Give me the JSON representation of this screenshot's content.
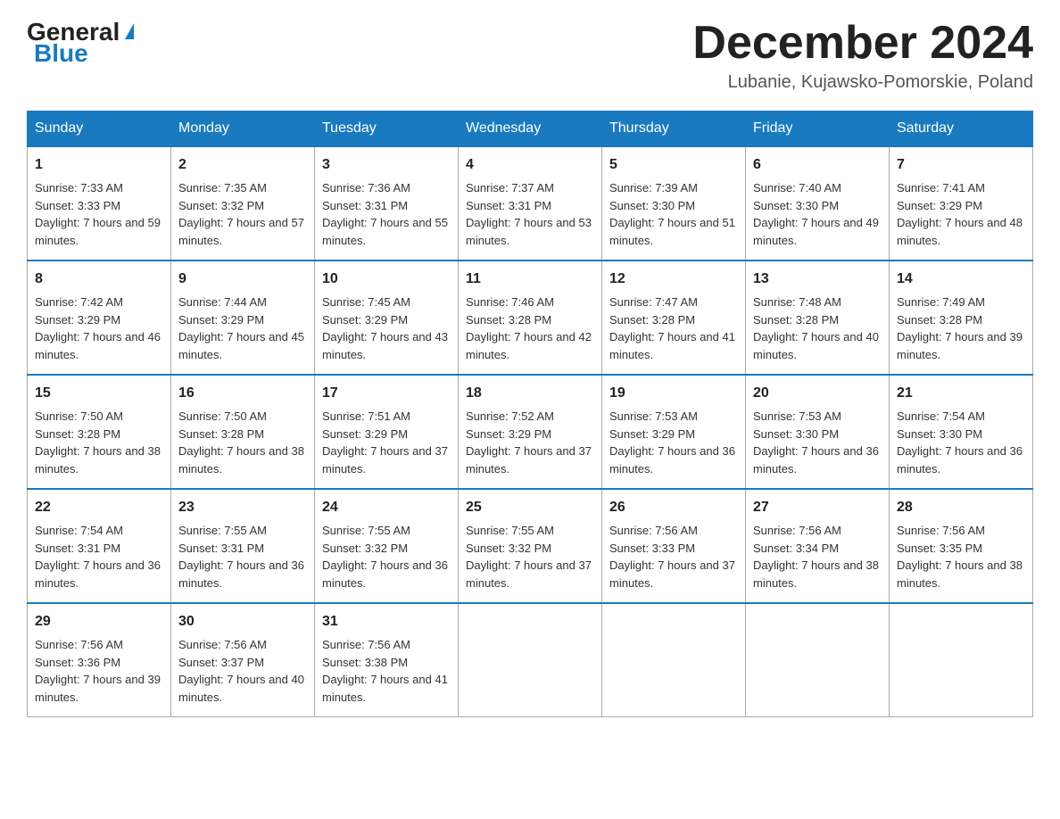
{
  "header": {
    "logo_general": "General",
    "logo_blue": "Blue",
    "month_title": "December 2024",
    "location": "Lubanie, Kujawsko-Pomorskie, Poland"
  },
  "days_of_week": [
    "Sunday",
    "Monday",
    "Tuesday",
    "Wednesday",
    "Thursday",
    "Friday",
    "Saturday"
  ],
  "weeks": [
    [
      {
        "day": "1",
        "sunrise": "Sunrise: 7:33 AM",
        "sunset": "Sunset: 3:33 PM",
        "daylight": "Daylight: 7 hours and 59 minutes."
      },
      {
        "day": "2",
        "sunrise": "Sunrise: 7:35 AM",
        "sunset": "Sunset: 3:32 PM",
        "daylight": "Daylight: 7 hours and 57 minutes."
      },
      {
        "day": "3",
        "sunrise": "Sunrise: 7:36 AM",
        "sunset": "Sunset: 3:31 PM",
        "daylight": "Daylight: 7 hours and 55 minutes."
      },
      {
        "day": "4",
        "sunrise": "Sunrise: 7:37 AM",
        "sunset": "Sunset: 3:31 PM",
        "daylight": "Daylight: 7 hours and 53 minutes."
      },
      {
        "day": "5",
        "sunrise": "Sunrise: 7:39 AM",
        "sunset": "Sunset: 3:30 PM",
        "daylight": "Daylight: 7 hours and 51 minutes."
      },
      {
        "day": "6",
        "sunrise": "Sunrise: 7:40 AM",
        "sunset": "Sunset: 3:30 PM",
        "daylight": "Daylight: 7 hours and 49 minutes."
      },
      {
        "day": "7",
        "sunrise": "Sunrise: 7:41 AM",
        "sunset": "Sunset: 3:29 PM",
        "daylight": "Daylight: 7 hours and 48 minutes."
      }
    ],
    [
      {
        "day": "8",
        "sunrise": "Sunrise: 7:42 AM",
        "sunset": "Sunset: 3:29 PM",
        "daylight": "Daylight: 7 hours and 46 minutes."
      },
      {
        "day": "9",
        "sunrise": "Sunrise: 7:44 AM",
        "sunset": "Sunset: 3:29 PM",
        "daylight": "Daylight: 7 hours and 45 minutes."
      },
      {
        "day": "10",
        "sunrise": "Sunrise: 7:45 AM",
        "sunset": "Sunset: 3:29 PM",
        "daylight": "Daylight: 7 hours and 43 minutes."
      },
      {
        "day": "11",
        "sunrise": "Sunrise: 7:46 AM",
        "sunset": "Sunset: 3:28 PM",
        "daylight": "Daylight: 7 hours and 42 minutes."
      },
      {
        "day": "12",
        "sunrise": "Sunrise: 7:47 AM",
        "sunset": "Sunset: 3:28 PM",
        "daylight": "Daylight: 7 hours and 41 minutes."
      },
      {
        "day": "13",
        "sunrise": "Sunrise: 7:48 AM",
        "sunset": "Sunset: 3:28 PM",
        "daylight": "Daylight: 7 hours and 40 minutes."
      },
      {
        "day": "14",
        "sunrise": "Sunrise: 7:49 AM",
        "sunset": "Sunset: 3:28 PM",
        "daylight": "Daylight: 7 hours and 39 minutes."
      }
    ],
    [
      {
        "day": "15",
        "sunrise": "Sunrise: 7:50 AM",
        "sunset": "Sunset: 3:28 PM",
        "daylight": "Daylight: 7 hours and 38 minutes."
      },
      {
        "day": "16",
        "sunrise": "Sunrise: 7:50 AM",
        "sunset": "Sunset: 3:28 PM",
        "daylight": "Daylight: 7 hours and 38 minutes."
      },
      {
        "day": "17",
        "sunrise": "Sunrise: 7:51 AM",
        "sunset": "Sunset: 3:29 PM",
        "daylight": "Daylight: 7 hours and 37 minutes."
      },
      {
        "day": "18",
        "sunrise": "Sunrise: 7:52 AM",
        "sunset": "Sunset: 3:29 PM",
        "daylight": "Daylight: 7 hours and 37 minutes."
      },
      {
        "day": "19",
        "sunrise": "Sunrise: 7:53 AM",
        "sunset": "Sunset: 3:29 PM",
        "daylight": "Daylight: 7 hours and 36 minutes."
      },
      {
        "day": "20",
        "sunrise": "Sunrise: 7:53 AM",
        "sunset": "Sunset: 3:30 PM",
        "daylight": "Daylight: 7 hours and 36 minutes."
      },
      {
        "day": "21",
        "sunrise": "Sunrise: 7:54 AM",
        "sunset": "Sunset: 3:30 PM",
        "daylight": "Daylight: 7 hours and 36 minutes."
      }
    ],
    [
      {
        "day": "22",
        "sunrise": "Sunrise: 7:54 AM",
        "sunset": "Sunset: 3:31 PM",
        "daylight": "Daylight: 7 hours and 36 minutes."
      },
      {
        "day": "23",
        "sunrise": "Sunrise: 7:55 AM",
        "sunset": "Sunset: 3:31 PM",
        "daylight": "Daylight: 7 hours and 36 minutes."
      },
      {
        "day": "24",
        "sunrise": "Sunrise: 7:55 AM",
        "sunset": "Sunset: 3:32 PM",
        "daylight": "Daylight: 7 hours and 36 minutes."
      },
      {
        "day": "25",
        "sunrise": "Sunrise: 7:55 AM",
        "sunset": "Sunset: 3:32 PM",
        "daylight": "Daylight: 7 hours and 37 minutes."
      },
      {
        "day": "26",
        "sunrise": "Sunrise: 7:56 AM",
        "sunset": "Sunset: 3:33 PM",
        "daylight": "Daylight: 7 hours and 37 minutes."
      },
      {
        "day": "27",
        "sunrise": "Sunrise: 7:56 AM",
        "sunset": "Sunset: 3:34 PM",
        "daylight": "Daylight: 7 hours and 38 minutes."
      },
      {
        "day": "28",
        "sunrise": "Sunrise: 7:56 AM",
        "sunset": "Sunset: 3:35 PM",
        "daylight": "Daylight: 7 hours and 38 minutes."
      }
    ],
    [
      {
        "day": "29",
        "sunrise": "Sunrise: 7:56 AM",
        "sunset": "Sunset: 3:36 PM",
        "daylight": "Daylight: 7 hours and 39 minutes."
      },
      {
        "day": "30",
        "sunrise": "Sunrise: 7:56 AM",
        "sunset": "Sunset: 3:37 PM",
        "daylight": "Daylight: 7 hours and 40 minutes."
      },
      {
        "day": "31",
        "sunrise": "Sunrise: 7:56 AM",
        "sunset": "Sunset: 3:38 PM",
        "daylight": "Daylight: 7 hours and 41 minutes."
      },
      null,
      null,
      null,
      null
    ]
  ]
}
